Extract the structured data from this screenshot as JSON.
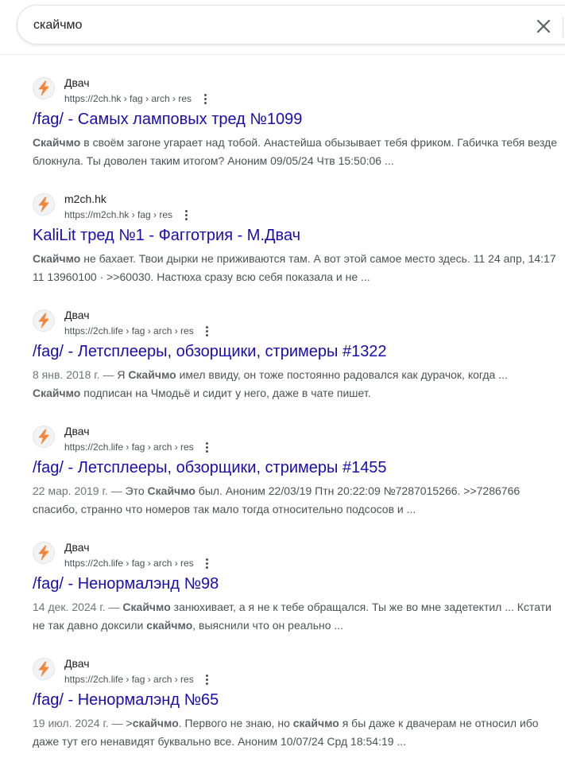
{
  "search": {
    "query": "скайчмо"
  },
  "colors": {
    "link": "#1a0dab",
    "icon_orange": "#f4863b"
  },
  "icons": {
    "clear": "close-icon",
    "site": "lightning-icon",
    "more": "more-vert-icon"
  },
  "results": [
    {
      "site": "Двач",
      "url": "https://2ch.hk › fag › arch › res",
      "title": "/fag/ - Самых ламповых тред №1099",
      "snippet": [
        {
          "b": "Скайчмо"
        },
        {
          "t": " в своём загоне угарает над тобой. Анастейша обызывает тебя фриком. Габичка тебя везде блокнула. Ты доволен таким итогом? Аноним 09/05/24 Чтв 15:50:06 ..."
        }
      ]
    },
    {
      "site": "m2ch.hk",
      "url": "https://m2ch.hk › fag › res",
      "title": "KaliLit тред №1 - Фагготрия - М.Двач",
      "snippet": [
        {
          "b": "Скайчмо"
        },
        {
          "t": " не бахает. Твои дырки не приживаются там. А вот этой самое место здесь. 11 24 апр, 14:17 11 13960100 · >>60030. Настюха сразу всю себя показала и не ..."
        }
      ]
    },
    {
      "site": "Двач",
      "url": "https://2ch.life › fag › arch › res",
      "title": "/fag/ - Летсплееры, обзорщики, стримеры #1322",
      "snippet": [
        {
          "d": "8 янв. 2018 г. — "
        },
        {
          "t": "Я "
        },
        {
          "b": "Скайчмо"
        },
        {
          "t": " имел ввиду, он тоже постоянно радовался как дурачок, когда ... "
        },
        {
          "b": "Скайчмо"
        },
        {
          "t": " подписан на Чмодьё и сидит у него, даже в чате пишет."
        }
      ]
    },
    {
      "site": "Двач",
      "url": "https://2ch.life › fag › arch › res",
      "title": "/fag/ - Летсплееры, обзорщики, стримеры #1455",
      "snippet": [
        {
          "d": "22 мар. 2019 г. — "
        },
        {
          "t": "Это "
        },
        {
          "b": "Скайчмо"
        },
        {
          "t": " был. Аноним 22/03/19 Птн 20:22:09 №7287015266. >>7286766 спасибо, странно что номеров так мало тогда относительно подсосов и ..."
        }
      ]
    },
    {
      "site": "Двач",
      "url": "https://2ch.life › fag › arch › res",
      "title": "/fag/ - Ненормалэнд №98",
      "snippet": [
        {
          "d": "14 дек. 2024 г. — "
        },
        {
          "b": "Скайчмо"
        },
        {
          "t": " занюхивает, а я не к тебе обращался. Ты же во мне задетектил ... Кстати не так давно доксили "
        },
        {
          "b": "скайчмо"
        },
        {
          "t": ", выяснили что он реально ..."
        }
      ]
    },
    {
      "site": "Двач",
      "url": "https://2ch.life › fag › arch › res",
      "title": "/fag/ - Ненормалэнд №65",
      "snippet": [
        {
          "d": "19 июл. 2024 г. — "
        },
        {
          "t": ">"
        },
        {
          "b": "скайчмо"
        },
        {
          "t": ". Первого не знаю, но "
        },
        {
          "b": "скайчмо"
        },
        {
          "t": " я бы даже к двачерам не относил ибо даже тут его ненавидят буквально все. Аноним 10/07/24 Срд 18:54:19 ..."
        }
      ]
    }
  ]
}
